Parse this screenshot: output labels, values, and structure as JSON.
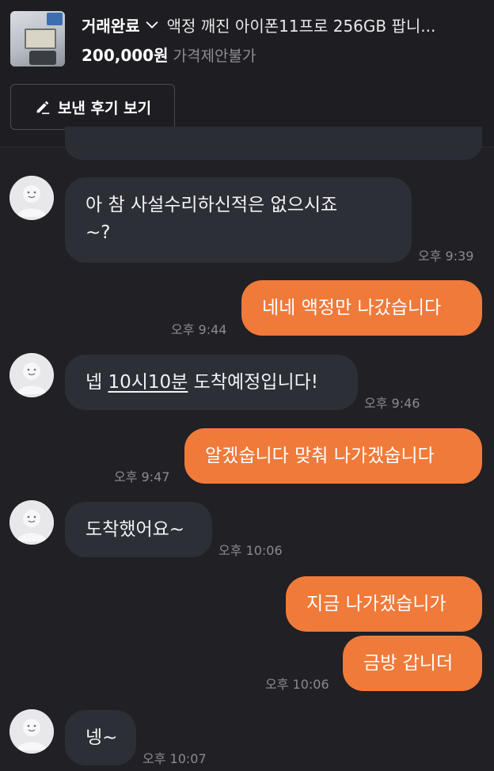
{
  "header": {
    "status": "거래완료",
    "title": "액정 깨진 아이폰11프로 256GB 팝니...",
    "price": "200,000원",
    "price_note": "가격제안불가",
    "review_button": "보낸 후기 보기",
    "thumbnail": "product-thumbnail"
  },
  "messages": [
    {
      "side": "in",
      "lines": [
        "아 참 사설수리하신적은 없으시죠",
        "~?"
      ],
      "time": "오후 9:39"
    },
    {
      "side": "out",
      "text": "네네 액정만 나갔습니다",
      "time": "오후 9:44"
    },
    {
      "side": "in",
      "pre": "넵 ",
      "link": "10시10분",
      "post": " 도착예정입니다!",
      "time": "오후 9:46"
    },
    {
      "side": "out",
      "text": "알겠숩니다 맞춰 나가겠숩니다",
      "time": "오후 9:47"
    },
    {
      "side": "in",
      "text": "도착했어요~",
      "time": "오후 10:06"
    },
    {
      "side": "out",
      "text": "지금 나가겠습니가"
    },
    {
      "side": "out",
      "text": "금방 갑니더",
      "time": "오후 10:06"
    },
    {
      "side": "in",
      "text": "넹~",
      "time": "오후 10:07"
    }
  ],
  "colors": {
    "background": "#202025",
    "incoming_bubble": "#2c2f35",
    "outgoing_bubble": "#f07a3a",
    "timestamp": "#8a8a90"
  },
  "icons": {
    "dropdown": "chevron-down-icon",
    "review": "pencil-icon",
    "avatar": "default-avatar-icon"
  }
}
